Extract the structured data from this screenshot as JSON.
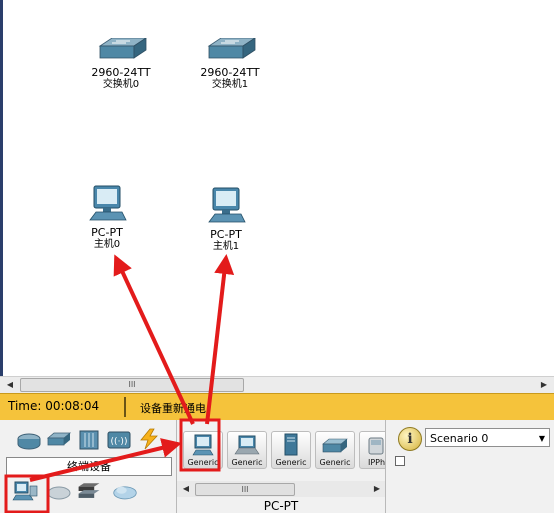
{
  "workspace": {
    "devices": [
      {
        "model": "2960-24TT",
        "name": "交换机0",
        "type": "switch"
      },
      {
        "model": "2960-24TT",
        "name": "交换机1",
        "type": "switch"
      },
      {
        "model": "PC-PT",
        "name": "主机0",
        "type": "pc"
      },
      {
        "model": "PC-PT",
        "name": "主机1",
        "type": "pc"
      }
    ]
  },
  "scrollbar": {
    "thumb_grip": "III",
    "left_arrow": "◀",
    "right_arrow": "▶"
  },
  "status_bar": {
    "time": "Time: 00:08:04",
    "message": "设备重新通电"
  },
  "category_panel": {
    "label": "终端设备",
    "top_icons": [
      "router-icon",
      "switch-icon",
      "hub-icon",
      "wireless-icon",
      "connection-icon"
    ],
    "bottom_icons": [
      "end-device-icon",
      "wan-icon",
      "custom-device-icon",
      "cloud-icon"
    ]
  },
  "device_panel": {
    "buttons": [
      {
        "label": "Generic",
        "icon": "pc-icon"
      },
      {
        "label": "Generic",
        "icon": "laptop-icon"
      },
      {
        "label": "Generic",
        "icon": "server-icon"
      },
      {
        "label": "Generic",
        "icon": "printer-icon"
      },
      {
        "label": "IPPho",
        "icon": "ip-phone-icon"
      }
    ],
    "scroll_grip": "III",
    "model_label": "PC-PT"
  },
  "scenario_panel": {
    "info_glyph": "i",
    "scenario": "Scenario 0"
  },
  "colors": {
    "status_bar": "#f5c33b",
    "annotation_red": "#e31b1b",
    "workspace_edge": "#2a3e6b"
  }
}
